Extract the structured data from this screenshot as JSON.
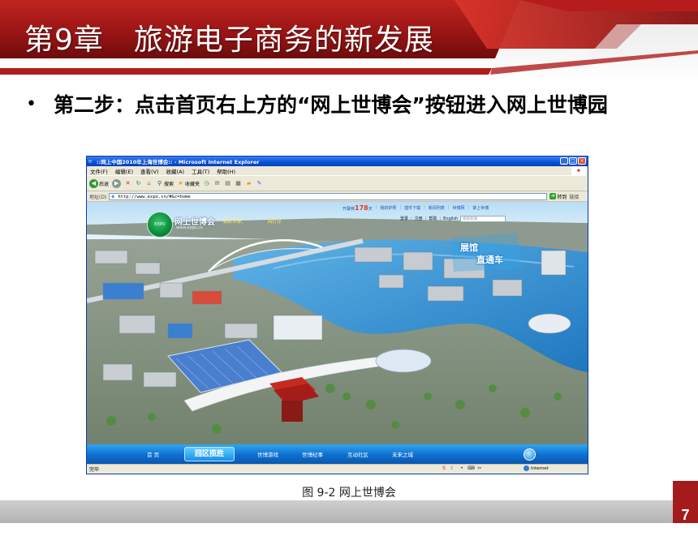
{
  "slide": {
    "chapter_title": "第9章　旅游电子商务的新发展",
    "bullet": "第二步：点击首页右上方的“网上世博会”按钮进入网上世博园",
    "caption": "图 9-2 网上世博会",
    "page_number": "7"
  },
  "browser": {
    "window_title": "::网上中国2010年上海世博会:: - Microsoft Internet Explorer",
    "menu": [
      "文件(F)",
      "编辑(E)",
      "查看(V)",
      "收藏(A)",
      "工具(T)",
      "帮助(H)"
    ],
    "toolbar": {
      "back": "后退",
      "search": "搜索",
      "favorites": "收藏夹"
    },
    "address_label": "地址(D)",
    "address": "http://www.expo.cn/#&c=home",
    "go": "转到",
    "links": "链接",
    "status": "完毕",
    "zone": "Internet"
  },
  "site": {
    "title": "网上世博会",
    "url": "www.expo.cn",
    "slogans": [
      "精彩世博，",
      "网打尽"
    ],
    "countdown_prefix": "开幕倒",
    "countdown_value": "178",
    "countdown_suffix": "天",
    "top_links": [
      "我的护照",
      "插件下载",
      "新闻列表",
      "世博网",
      "掌上世博"
    ],
    "sub_links": [
      "登录",
      "注册",
      "帮助",
      "English"
    ],
    "search_placeholder": "搜索新闻",
    "express_line1": "展馆",
    "express_line2": "直通车",
    "nav": [
      "首 页",
      "园区揽胜",
      "世博游戏",
      "世博纪事",
      "互动社区",
      "未来之城"
    ],
    "nav_active_index": 1
  },
  "colors": {
    "brand_red": "#a41b1b",
    "nav_blue": "#0d6fd0",
    "river_blue": "#2b86c8"
  }
}
